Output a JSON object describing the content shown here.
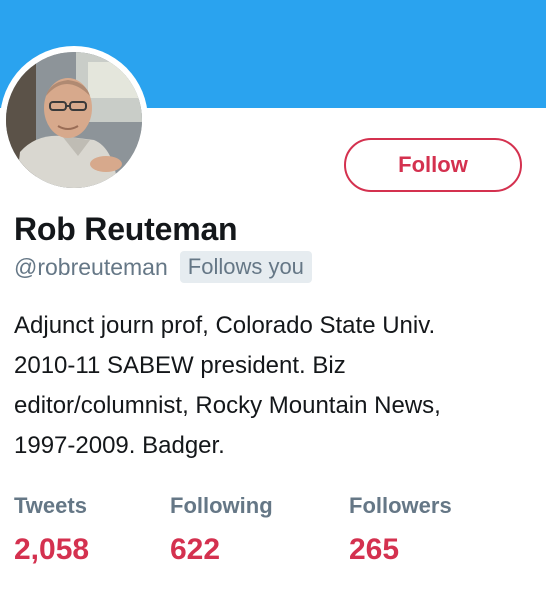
{
  "profile": {
    "name": "Rob Reuteman",
    "handle": "@robreuteman",
    "follows_you_badge": "Follows you",
    "follow_button_label": "Follow",
    "bio_lines": [
      "Adjunct journ prof, Colorado State Univ.",
      "2010-11 SABEW president. Biz",
      "editor/columnist, Rocky Mountain News,",
      "1997-2009. Badger."
    ]
  },
  "stats": [
    {
      "label": "Tweets",
      "value": "2,058"
    },
    {
      "label": "Following",
      "value": "622"
    },
    {
      "label": "Followers",
      "value": "265"
    }
  ],
  "colors": {
    "banner": "#2aa3ef",
    "accent": "#d4314f",
    "secondary_text": "#657786",
    "badge_bg": "#e6ecf0"
  }
}
